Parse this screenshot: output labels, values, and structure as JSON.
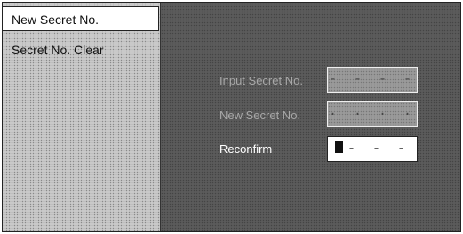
{
  "menu": {
    "items": [
      {
        "label": "New Secret No.",
        "selected": true
      },
      {
        "label": "Secret No. Clear",
        "selected": false
      }
    ]
  },
  "form": {
    "input_secret": {
      "label": "Input Secret No.",
      "value": "- - - -"
    },
    "new_secret": {
      "label": "New Secret No.",
      "value": "· · · ·"
    },
    "reconfirm": {
      "label": "Reconfirm",
      "value": "- - -"
    }
  }
}
